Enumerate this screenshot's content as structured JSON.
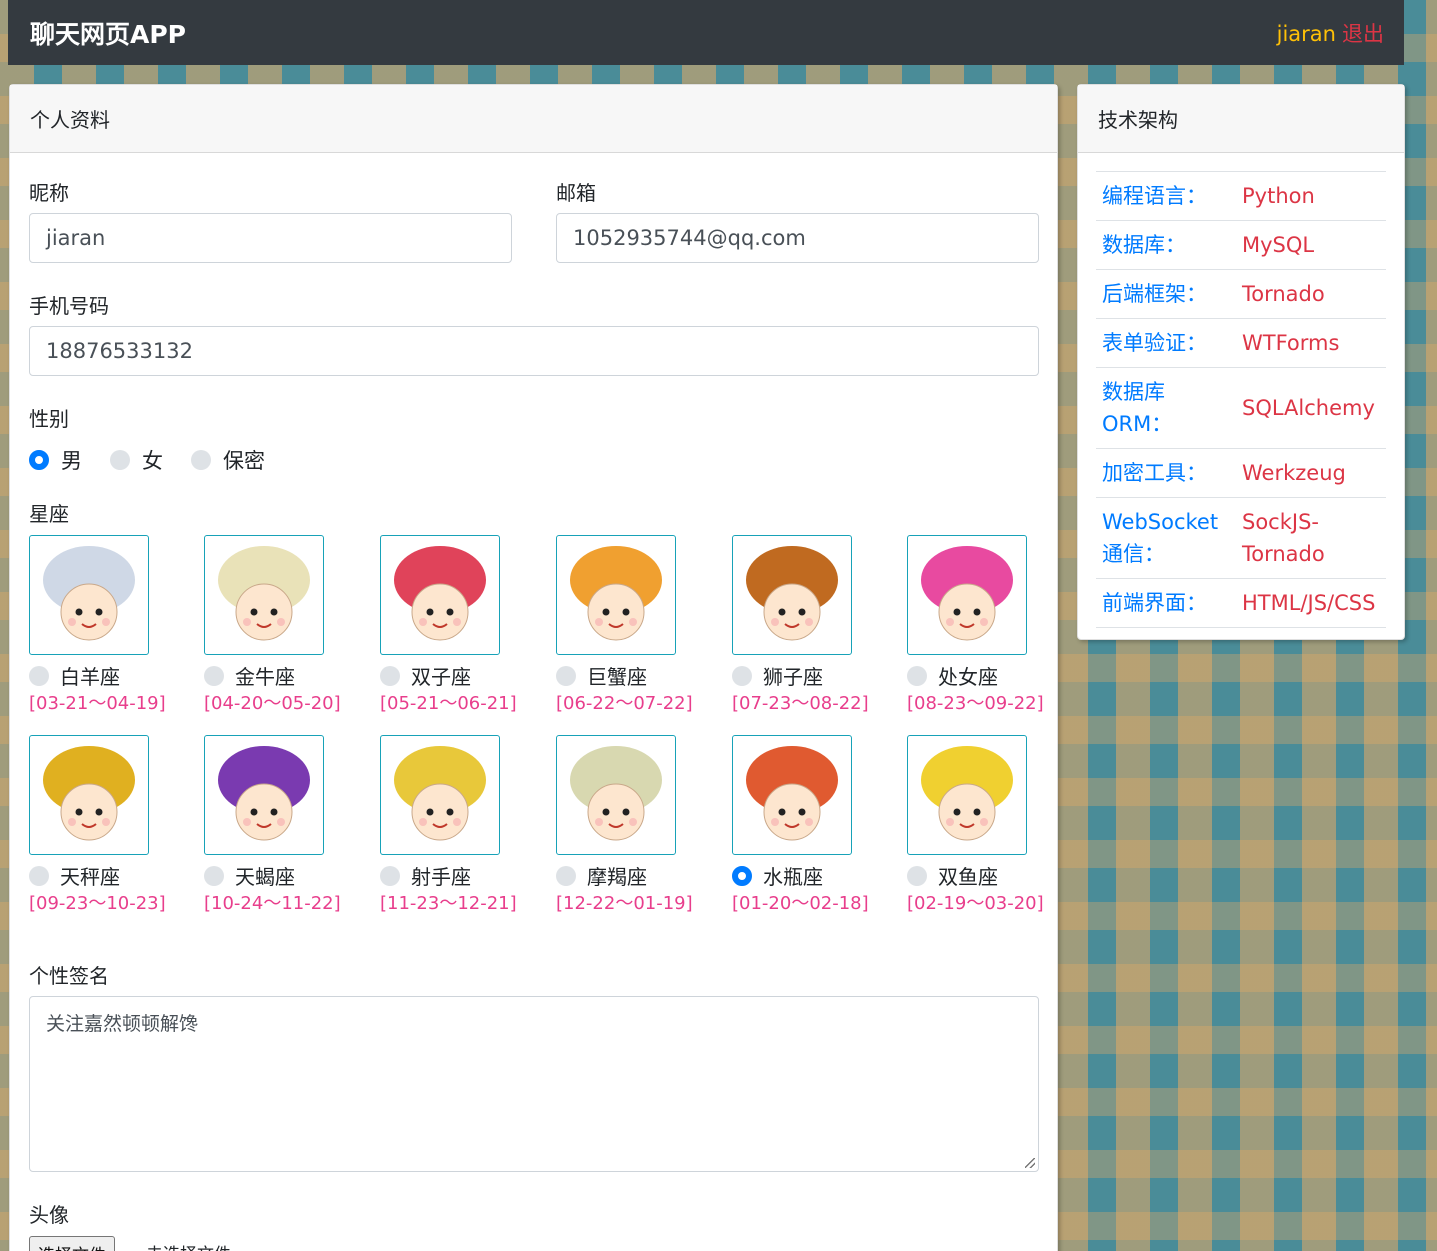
{
  "navbar": {
    "brand": "聊天网页APP",
    "user": "jiaran",
    "logout": "退出"
  },
  "profile": {
    "header": "个人资料",
    "nickname_label": "昵称",
    "nickname": "jiaran",
    "email_label": "邮箱",
    "email": "1052935744@qq.com",
    "phone_label": "手机号码",
    "phone": "18876533132",
    "gender_label": "性别",
    "genders": [
      {
        "label": "男",
        "checked": true
      },
      {
        "label": "女",
        "checked": false
      },
      {
        "label": "保密",
        "checked": false
      }
    ],
    "zodiac_label": "星座",
    "zodiacs": [
      {
        "name": "白羊座",
        "date": "[03-21～04-19]",
        "color": "#cfd8e6",
        "checked": false
      },
      {
        "name": "金牛座",
        "date": "[04-20～05-20]",
        "color": "#e9e2b8",
        "checked": false
      },
      {
        "name": "双子座",
        "date": "[05-21～06-21]",
        "color": "#e0435a",
        "checked": false
      },
      {
        "name": "巨蟹座",
        "date": "[06-22～07-22]",
        "color": "#f0a030",
        "checked": false
      },
      {
        "name": "狮子座",
        "date": "[07-23～08-22]",
        "color": "#c06a20",
        "checked": false
      },
      {
        "name": "处女座",
        "date": "[08-23～09-22]",
        "color": "#e84aa0",
        "checked": false
      },
      {
        "name": "天秤座",
        "date": "[09-23～10-23]",
        "color": "#e0b020",
        "checked": false
      },
      {
        "name": "天蝎座",
        "date": "[10-24～11-22]",
        "color": "#7a3ab0",
        "checked": false
      },
      {
        "name": "射手座",
        "date": "[11-23～12-21]",
        "color": "#e8c83a",
        "checked": false
      },
      {
        "name": "摩羯座",
        "date": "[12-22～01-19]",
        "color": "#d8d8b0",
        "checked": false
      },
      {
        "name": "水瓶座",
        "date": "[01-20～02-18]",
        "color": "#e05a30",
        "checked": true
      },
      {
        "name": "双鱼座",
        "date": "[02-19～03-20]",
        "color": "#f0d030",
        "checked": false
      }
    ],
    "signature_label": "个性签名",
    "signature": "关注嘉然顿顿解馋",
    "avatar_label": "头像",
    "file_button": "选择文件",
    "file_status": "未选择文件"
  },
  "tech": {
    "header": "技术架构",
    "rows": [
      {
        "key": "编程语言：",
        "value": "Python"
      },
      {
        "key": "数据库：",
        "value": "MySQL"
      },
      {
        "key": "后端框架：",
        "value": "Tornado"
      },
      {
        "key": "表单验证：",
        "value": "WTForms"
      },
      {
        "key": "数据库ORM：",
        "value": "SQLAlchemy"
      },
      {
        "key": "加密工具：",
        "value": "Werkzeug"
      },
      {
        "key": "WebSocket通信：",
        "value": "SockJS-Tornado"
      },
      {
        "key": "前端界面：",
        "value": "HTML/JS/CSS"
      }
    ]
  }
}
